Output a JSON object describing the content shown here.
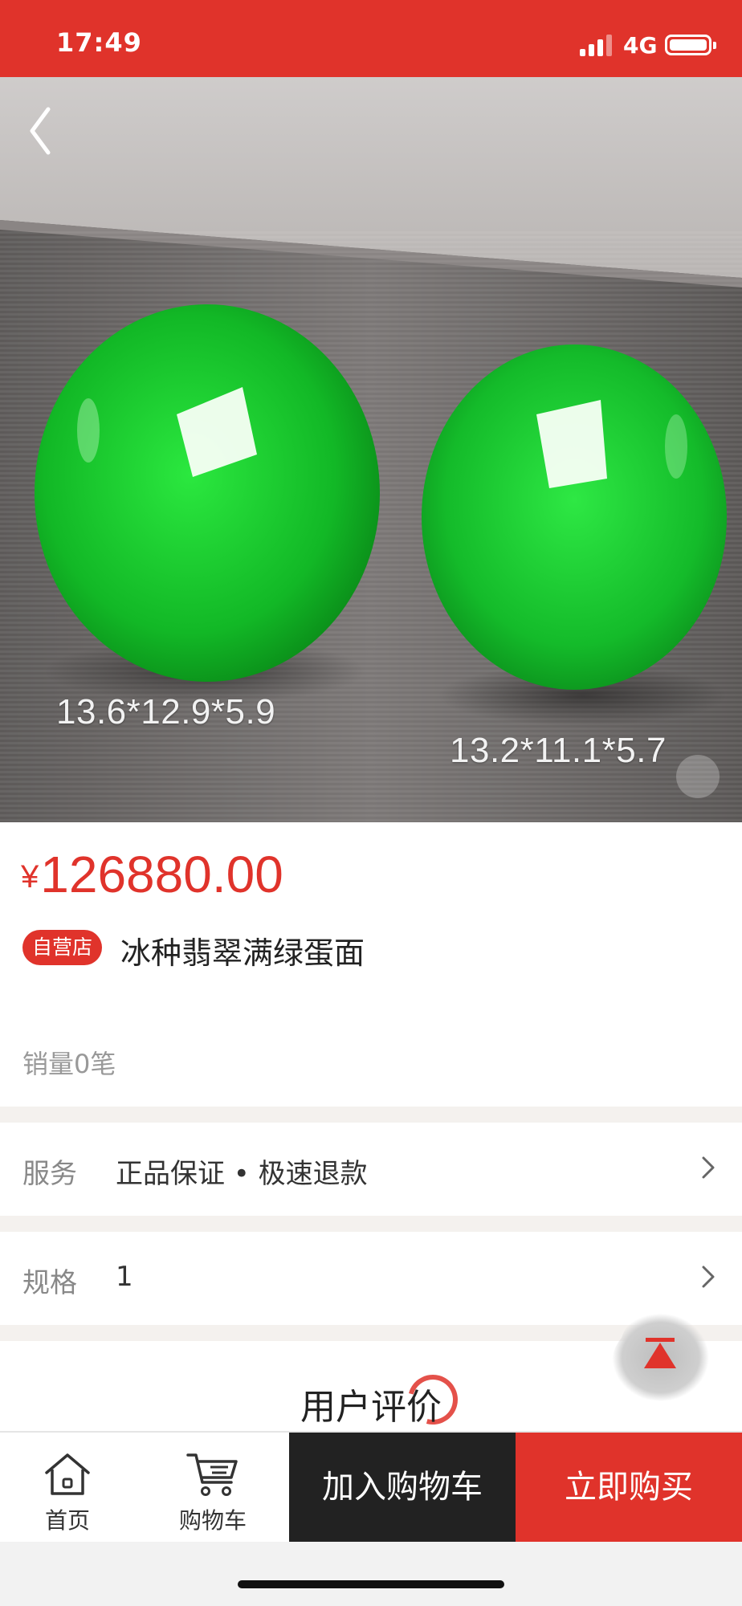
{
  "status_bar": {
    "time": "17:49",
    "network": "4G",
    "background_color": "#e0332b"
  },
  "navigation": {
    "back_icon": "chevron-left-icon"
  },
  "product_image": {
    "left_dimension": "13.6*12.9*5.9",
    "right_dimension": "13.2*11.1*5.7",
    "jade_color": "#17c02c"
  },
  "product": {
    "currency_symbol": "¥",
    "price": "126880.00",
    "store_tag": "自营店",
    "title": "冰种翡翠满绿蛋面",
    "sales": "销量0笔",
    "price_color": "#e0332b"
  },
  "service_row": {
    "label": "服务",
    "value": "正品保证 • 极速退款"
  },
  "spec_row": {
    "label": "规格",
    "value": "1"
  },
  "reviews": {
    "title": "用户评价"
  },
  "back_to_top_icon": "arrow-up-icon",
  "bottom_bar": {
    "home_label": "首页",
    "home_icon": "home-icon",
    "cart_label": "购物车",
    "cart_icon": "cart-icon",
    "add_to_cart": "加入购物车",
    "buy_now": "立即购买"
  }
}
